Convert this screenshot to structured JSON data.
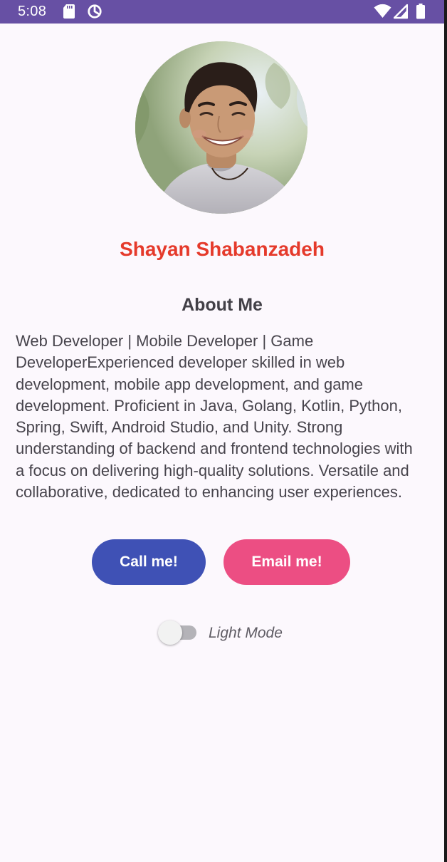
{
  "status_bar": {
    "time": "5:08",
    "left_icons": [
      "sd-card-icon",
      "data-saver-icon"
    ],
    "right_icons": [
      "wifi-icon",
      "signal-icon",
      "battery-icon"
    ],
    "background_color": "#6750a4"
  },
  "profile": {
    "name": "Shayan Shabanzadeh",
    "name_color": "#e53a2b"
  },
  "about": {
    "title": "About Me",
    "text": "Web Developer | Mobile Developer | Game DeveloperExperienced developer skilled in web development, mobile app development, and game development. Proficient in Java, Golang, Kotlin, Python, Spring, Swift, Android Studio, and Unity. Strong understanding of backend and frontend technologies with a focus on delivering high-quality solutions. Versatile and collaborative, dedicated to enhancing user experiences."
  },
  "actions": {
    "call_label": "Call me!",
    "call_color": "#3f51b5",
    "email_label": "Email me!",
    "email_color": "#ec4e83"
  },
  "theme_switch": {
    "label": "Light Mode",
    "checked": false
  }
}
